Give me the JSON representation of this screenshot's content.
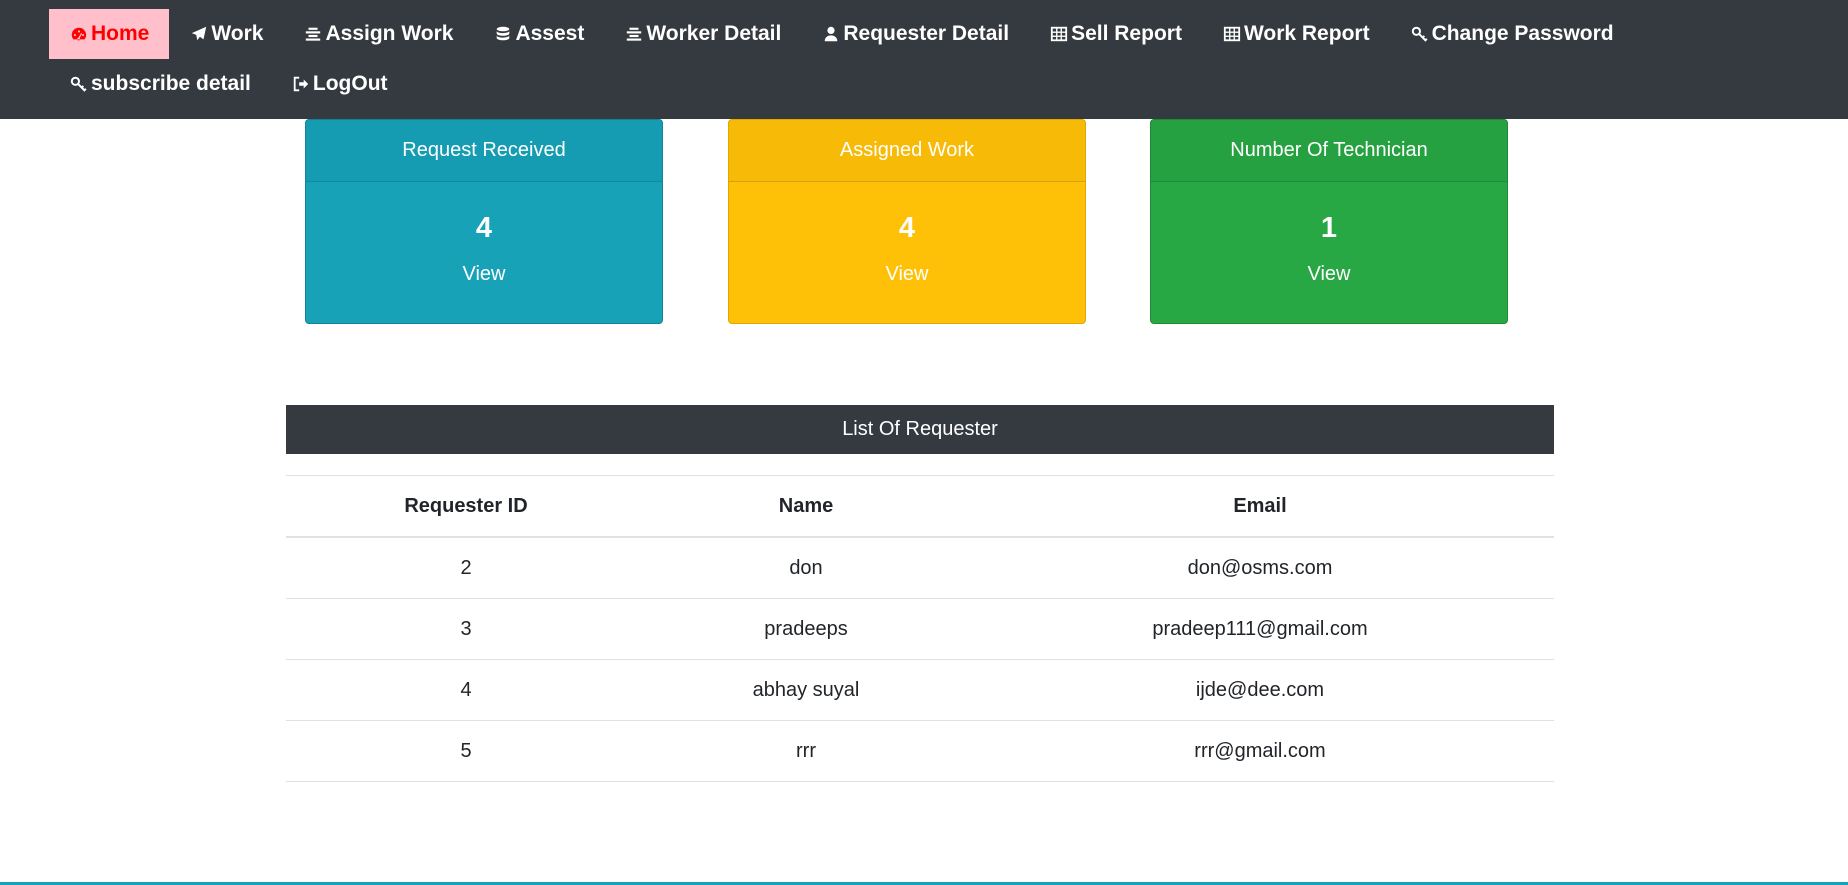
{
  "nav": {
    "items": [
      {
        "label": "Home",
        "icon": "dashboard-icon",
        "active": true
      },
      {
        "label": "Work",
        "icon": "paper-plane-icon"
      },
      {
        "label": "Assign Work",
        "icon": "align-center-icon"
      },
      {
        "label": "Assest",
        "icon": "database-icon"
      },
      {
        "label": "Worker Detail",
        "icon": "align-center-icon"
      },
      {
        "label": "Requester Detail",
        "icon": "user-icon"
      },
      {
        "label": "Sell Report",
        "icon": "table-icon"
      },
      {
        "label": "Work Report",
        "icon": "table-icon"
      },
      {
        "label": "Change Password",
        "icon": "key-icon"
      },
      {
        "label": "subscribe detail",
        "icon": "key-icon"
      },
      {
        "label": "LogOut",
        "icon": "sign-out-icon"
      }
    ]
  },
  "cards": [
    {
      "title": "Request Received",
      "count": "4",
      "link": "View",
      "color": "#17a2b8"
    },
    {
      "title": "Assigned Work",
      "count": "4",
      "link": "View",
      "color": "#ffc107"
    },
    {
      "title": "Number Of Technician",
      "count": "1",
      "link": "View",
      "color": "#28a745"
    }
  ],
  "requester_list": {
    "title": "List Of Requester",
    "columns": [
      "Requester ID",
      "Name",
      "Email"
    ],
    "rows": [
      [
        "2",
        "don",
        "don@osms.com"
      ],
      [
        "3",
        "pradeeps",
        "pradeep111@gmail.com"
      ],
      [
        "4",
        "abhay suyal",
        "ijde@dee.com"
      ],
      [
        "5",
        "rrr",
        "rrr@gmail.com"
      ]
    ]
  },
  "colors": {
    "navbar": "#343a40",
    "active_bg": "#ffc0cb",
    "active_text": "#ff0000"
  }
}
